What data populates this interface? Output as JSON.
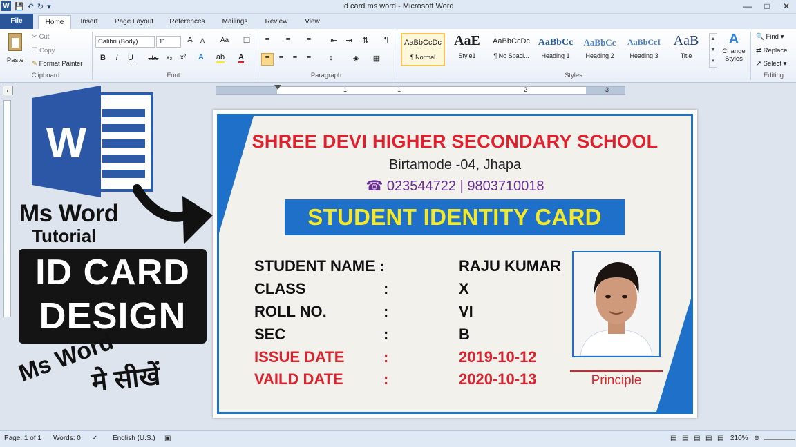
{
  "titlebar": {
    "title": "id card ms word  -  Microsoft Word",
    "app_logo": "W",
    "qat_icons": [
      "save-icon",
      "undo-icon",
      "redo-icon",
      "customize-icon"
    ],
    "controls": [
      "minimize-icon",
      "maximize-icon",
      "close-icon"
    ]
  },
  "tabs": [
    "File",
    "Home",
    "Insert",
    "Page Layout",
    "References",
    "Mailings",
    "Review",
    "View"
  ],
  "ribbon": {
    "clipboard": {
      "paste": "Paste",
      "cut": "Cut",
      "copy": "Copy",
      "format_painter": "Format Painter",
      "label": "Clipboard"
    },
    "font": {
      "font_name": "Calibri (Body)",
      "font_size": "11",
      "label": "Font",
      "bold": "B",
      "italic": "I",
      "underline": "U",
      "strike": "abe",
      "sub": "x₂",
      "sup": "x²",
      "aa": "Aa",
      "grow": "A",
      "shrink": "A"
    },
    "paragraph": {
      "label": "Paragraph",
      "pilcrow": "¶"
    },
    "styles": {
      "label": "Styles",
      "items": [
        {
          "sample": "AaBbCcDc",
          "name": "¶ Normal"
        },
        {
          "sample": "AaE",
          "name": "Style1"
        },
        {
          "sample": "AaBbCcDc",
          "name": "¶ No Spaci..."
        },
        {
          "sample": "AaBbCc",
          "name": "Heading 1"
        },
        {
          "sample": "AaBbCc",
          "name": "Heading 2"
        },
        {
          "sample": "AaBbCcI",
          "name": "Heading 3"
        },
        {
          "sample": "AaB",
          "name": "Title"
        }
      ],
      "change_styles": "Change Styles",
      "change_styles_icon": "A"
    },
    "editing": {
      "label": "Editing",
      "find": "Find",
      "replace": "Replace",
      "select": "Select"
    }
  },
  "ruler": {
    "marks": [
      "1",
      "1",
      "2",
      "3"
    ]
  },
  "branding": {
    "icon_letter": "W",
    "ms_word": "Ms Word",
    "tutorial": "Tutorial",
    "line1": "ID CARD",
    "line2": "DESIGN",
    "ms_word2": "Ms Word",
    "hindi": "मे सीखें"
  },
  "card": {
    "school": "SHREE DEVI HIGHER SECONDARY SCHOOL",
    "address": "Birtamode -04, Jhapa",
    "phone": "☎ 023544722 | 9803710018",
    "banner": "STUDENT IDENTITY CARD",
    "fields": [
      {
        "label": "STUDENT NAME :",
        "colon": "",
        "value": "RAJU KUMAR",
        "red": false
      },
      {
        "label": "CLASS",
        "colon": ":",
        "value": "X",
        "red": false
      },
      {
        "label": "ROLL NO.",
        "colon": ":",
        "value": "VI",
        "red": false
      },
      {
        "label": "SEC",
        "colon": ":",
        "value": "B",
        "red": false
      },
      {
        "label": "ISSUE DATE",
        "colon": ":",
        "value": "2019-10-12",
        "red": true
      },
      {
        "label": "VAILD DATE",
        "colon": ":",
        "value": "2020-10-13",
        "red": true
      }
    ],
    "principal": "Principle",
    "colors": {
      "accent_blue": "#1e70c9",
      "red": "#d9232e",
      "yellow": "#f3e92a",
      "purple": "#6a2d96"
    }
  },
  "status": {
    "page": "Page: 1 of 1",
    "words": "Words: 0",
    "language": "English (U.S.)",
    "zoom": "210%"
  }
}
